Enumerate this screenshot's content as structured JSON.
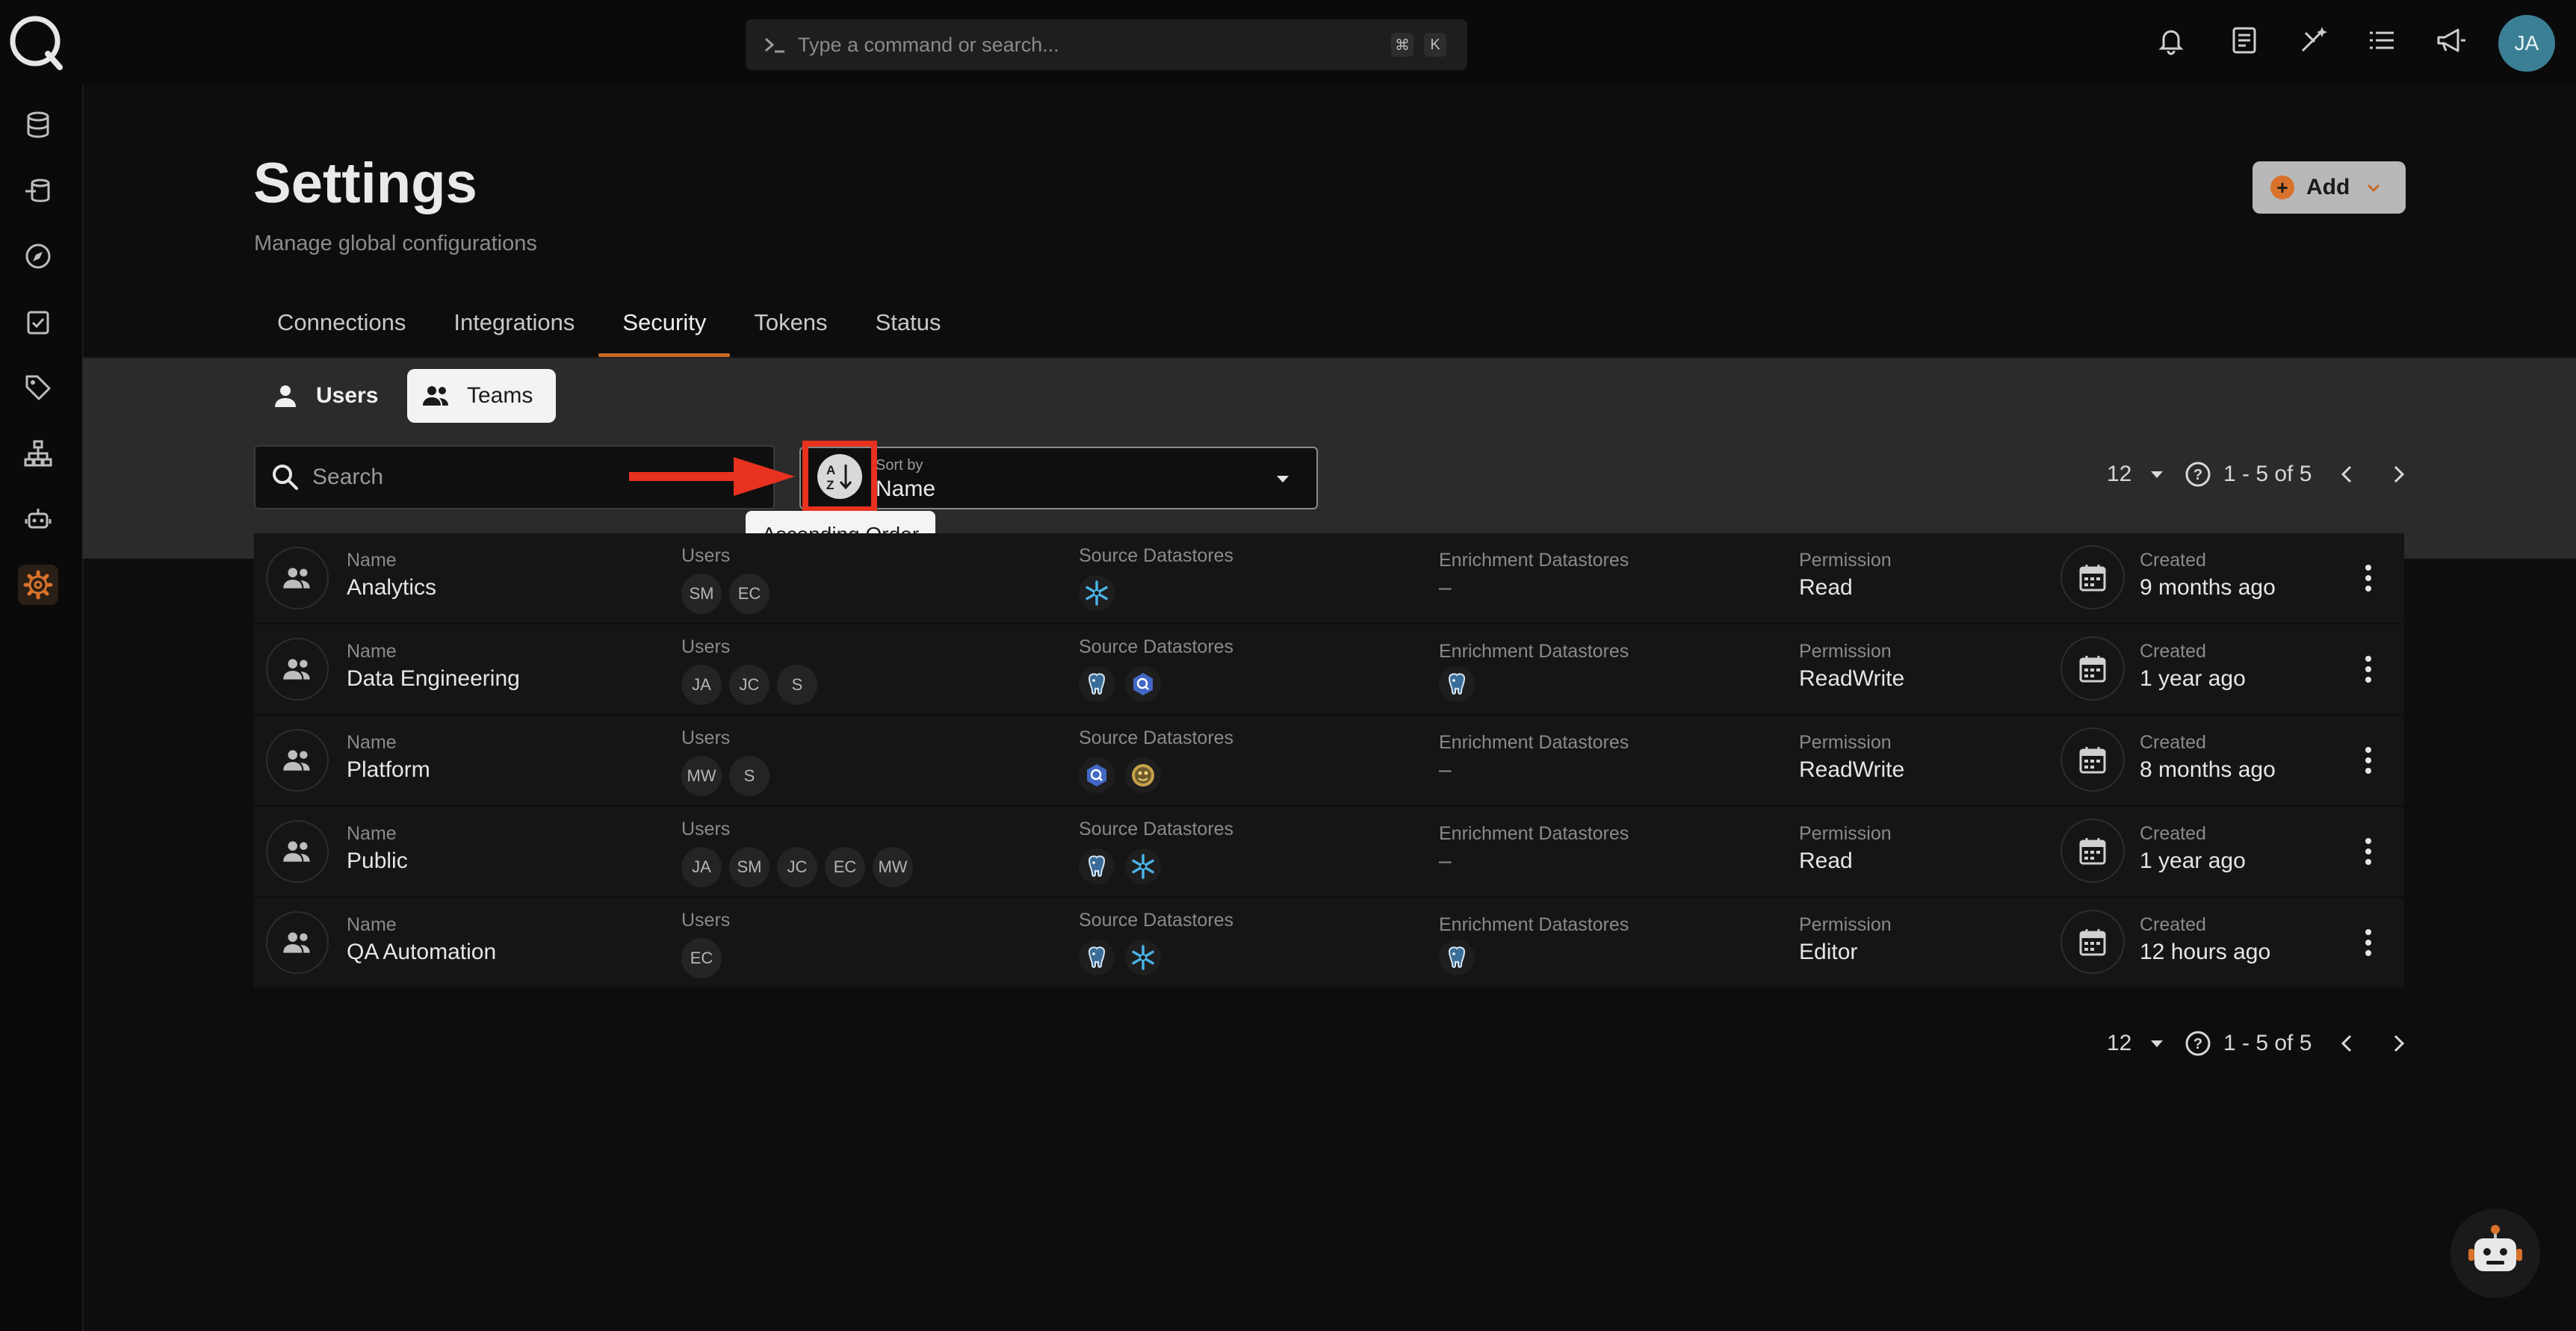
{
  "topbar": {
    "command_placeholder": "Type a command or search...",
    "shortcut_cmd": "⌘",
    "shortcut_key": "K",
    "user_initials": "JA"
  },
  "page": {
    "title": "Settings",
    "subtitle": "Manage global configurations",
    "add_label": "Add"
  },
  "tabs": [
    "Connections",
    "Integrations",
    "Security",
    "Tokens",
    "Status"
  ],
  "active_tab": "Security",
  "toggle": {
    "users_label": "Users",
    "teams_label": "Teams",
    "active": "Teams"
  },
  "search": {
    "placeholder": "Search",
    "value": ""
  },
  "sort": {
    "label": "Sort by",
    "value": "Name",
    "direction_tooltip": "Ascending Order",
    "direction_icon": "sort-az-ascending-icon"
  },
  "pagination": {
    "per_page": "12",
    "range": "1 - 5 of 5"
  },
  "columns": {
    "name": "Name",
    "users": "Users",
    "source": "Source Datastores",
    "enrichment": "Enrichment Datastores",
    "permission": "Permission",
    "created": "Created"
  },
  "teams": [
    {
      "name": "Analytics",
      "users": [
        "SM",
        "EC"
      ],
      "source": [
        "snowflake"
      ],
      "enrichment_empty": "–",
      "enrichment": [],
      "permission": "Read",
      "created": "9 months ago"
    },
    {
      "name": "Data Engineering",
      "users": [
        "JA",
        "JC",
        "S"
      ],
      "source": [
        "postgresql",
        "bigquery"
      ],
      "enrichment_empty": "",
      "enrichment": [
        "postgresql"
      ],
      "permission": "ReadWrite",
      "created": "1 year ago"
    },
    {
      "name": "Platform",
      "users": [
        "MW",
        "S"
      ],
      "source": [
        "bigquery",
        "hive"
      ],
      "enrichment_empty": "–",
      "enrichment": [],
      "permission": "ReadWrite",
      "created": "8 months ago"
    },
    {
      "name": "Public",
      "users": [
        "JA",
        "SM",
        "JC",
        "EC",
        "MW"
      ],
      "source": [
        "postgresql",
        "snowflake"
      ],
      "enrichment_empty": "–",
      "enrichment": [],
      "permission": "Read",
      "created": "1 year ago"
    },
    {
      "name": "QA Automation",
      "users": [
        "EC"
      ],
      "source": [
        "postgresql",
        "snowflake"
      ],
      "enrichment_empty": "",
      "enrichment": [
        "postgresql"
      ],
      "permission": "Editor",
      "created": "12 hours ago"
    }
  ],
  "colors": {
    "accent": "#c56a24",
    "highlight": "#e8311f",
    "avatar": "#3b7f95"
  }
}
